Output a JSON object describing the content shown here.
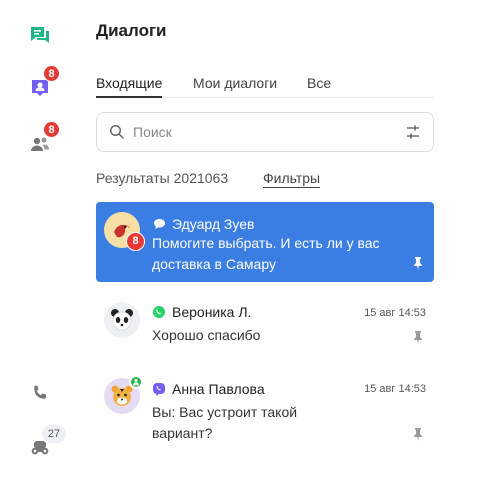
{
  "rail": {
    "chats_badge": "8",
    "contacts_badge": "8",
    "bots_badge": "27"
  },
  "header": {
    "title": "Диалоги"
  },
  "tabs": [
    {
      "label": "Входящие",
      "active": true
    },
    {
      "label": "Мои диалоги",
      "active": false
    },
    {
      "label": "Все",
      "active": false
    }
  ],
  "search": {
    "placeholder": "Поиск",
    "value": ""
  },
  "results": {
    "label": "Результаты 2021063",
    "filters_label": "Фильтры"
  },
  "dialogs": [
    {
      "name": "Эдуард Зуев",
      "channel": "chat-bubble-icon",
      "preview": "Помогите выбрать. И есть ли у вас доставка в Самару",
      "unread": "8",
      "time": "",
      "selected": true,
      "avatar": "bird-avatar"
    },
    {
      "name": "Вероника Л.",
      "channel": "whatsapp-icon",
      "preview": "Хорошо спасибо",
      "unread": "",
      "time": "15 авг 14:53",
      "selected": false,
      "avatar": "panda-avatar"
    },
    {
      "name": "Анна Павлова",
      "channel": "viber-icon",
      "preview": "Вы: Вас устроит такой вариант?",
      "unread": "",
      "time": "15 авг 14:53",
      "selected": false,
      "avatar": "tiger-avatar"
    }
  ],
  "colors": {
    "accent": "#3a7ee4",
    "brand_green": "#21b58a",
    "badge_red": "#e53935",
    "whatsapp": "#25d366",
    "viber": "#7360f2"
  }
}
